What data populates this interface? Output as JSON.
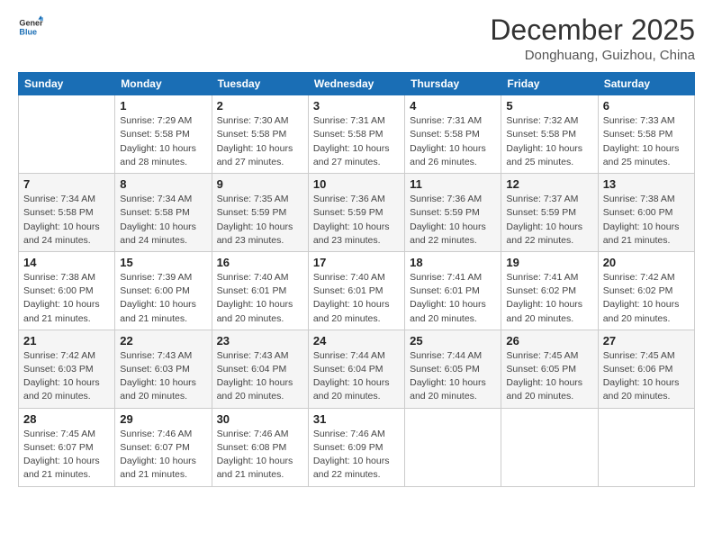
{
  "logo": {
    "line1": "General",
    "line2": "Blue"
  },
  "title": "December 2025",
  "subtitle": "Donghuang, Guizhou, China",
  "weekdays": [
    "Sunday",
    "Monday",
    "Tuesday",
    "Wednesday",
    "Thursday",
    "Friday",
    "Saturday"
  ],
  "weeks": [
    [
      {
        "num": "",
        "info": ""
      },
      {
        "num": "1",
        "info": "Sunrise: 7:29 AM\nSunset: 5:58 PM\nDaylight: 10 hours\nand 28 minutes."
      },
      {
        "num": "2",
        "info": "Sunrise: 7:30 AM\nSunset: 5:58 PM\nDaylight: 10 hours\nand 27 minutes."
      },
      {
        "num": "3",
        "info": "Sunrise: 7:31 AM\nSunset: 5:58 PM\nDaylight: 10 hours\nand 27 minutes."
      },
      {
        "num": "4",
        "info": "Sunrise: 7:31 AM\nSunset: 5:58 PM\nDaylight: 10 hours\nand 26 minutes."
      },
      {
        "num": "5",
        "info": "Sunrise: 7:32 AM\nSunset: 5:58 PM\nDaylight: 10 hours\nand 25 minutes."
      },
      {
        "num": "6",
        "info": "Sunrise: 7:33 AM\nSunset: 5:58 PM\nDaylight: 10 hours\nand 25 minutes."
      }
    ],
    [
      {
        "num": "7",
        "info": "Sunrise: 7:34 AM\nSunset: 5:58 PM\nDaylight: 10 hours\nand 24 minutes."
      },
      {
        "num": "8",
        "info": "Sunrise: 7:34 AM\nSunset: 5:58 PM\nDaylight: 10 hours\nand 24 minutes."
      },
      {
        "num": "9",
        "info": "Sunrise: 7:35 AM\nSunset: 5:59 PM\nDaylight: 10 hours\nand 23 minutes."
      },
      {
        "num": "10",
        "info": "Sunrise: 7:36 AM\nSunset: 5:59 PM\nDaylight: 10 hours\nand 23 minutes."
      },
      {
        "num": "11",
        "info": "Sunrise: 7:36 AM\nSunset: 5:59 PM\nDaylight: 10 hours\nand 22 minutes."
      },
      {
        "num": "12",
        "info": "Sunrise: 7:37 AM\nSunset: 5:59 PM\nDaylight: 10 hours\nand 22 minutes."
      },
      {
        "num": "13",
        "info": "Sunrise: 7:38 AM\nSunset: 6:00 PM\nDaylight: 10 hours\nand 21 minutes."
      }
    ],
    [
      {
        "num": "14",
        "info": "Sunrise: 7:38 AM\nSunset: 6:00 PM\nDaylight: 10 hours\nand 21 minutes."
      },
      {
        "num": "15",
        "info": "Sunrise: 7:39 AM\nSunset: 6:00 PM\nDaylight: 10 hours\nand 21 minutes."
      },
      {
        "num": "16",
        "info": "Sunrise: 7:40 AM\nSunset: 6:01 PM\nDaylight: 10 hours\nand 20 minutes."
      },
      {
        "num": "17",
        "info": "Sunrise: 7:40 AM\nSunset: 6:01 PM\nDaylight: 10 hours\nand 20 minutes."
      },
      {
        "num": "18",
        "info": "Sunrise: 7:41 AM\nSunset: 6:01 PM\nDaylight: 10 hours\nand 20 minutes."
      },
      {
        "num": "19",
        "info": "Sunrise: 7:41 AM\nSunset: 6:02 PM\nDaylight: 10 hours\nand 20 minutes."
      },
      {
        "num": "20",
        "info": "Sunrise: 7:42 AM\nSunset: 6:02 PM\nDaylight: 10 hours\nand 20 minutes."
      }
    ],
    [
      {
        "num": "21",
        "info": "Sunrise: 7:42 AM\nSunset: 6:03 PM\nDaylight: 10 hours\nand 20 minutes."
      },
      {
        "num": "22",
        "info": "Sunrise: 7:43 AM\nSunset: 6:03 PM\nDaylight: 10 hours\nand 20 minutes."
      },
      {
        "num": "23",
        "info": "Sunrise: 7:43 AM\nSunset: 6:04 PM\nDaylight: 10 hours\nand 20 minutes."
      },
      {
        "num": "24",
        "info": "Sunrise: 7:44 AM\nSunset: 6:04 PM\nDaylight: 10 hours\nand 20 minutes."
      },
      {
        "num": "25",
        "info": "Sunrise: 7:44 AM\nSunset: 6:05 PM\nDaylight: 10 hours\nand 20 minutes."
      },
      {
        "num": "26",
        "info": "Sunrise: 7:45 AM\nSunset: 6:05 PM\nDaylight: 10 hours\nand 20 minutes."
      },
      {
        "num": "27",
        "info": "Sunrise: 7:45 AM\nSunset: 6:06 PM\nDaylight: 10 hours\nand 20 minutes."
      }
    ],
    [
      {
        "num": "28",
        "info": "Sunrise: 7:45 AM\nSunset: 6:07 PM\nDaylight: 10 hours\nand 21 minutes."
      },
      {
        "num": "29",
        "info": "Sunrise: 7:46 AM\nSunset: 6:07 PM\nDaylight: 10 hours\nand 21 minutes."
      },
      {
        "num": "30",
        "info": "Sunrise: 7:46 AM\nSunset: 6:08 PM\nDaylight: 10 hours\nand 21 minutes."
      },
      {
        "num": "31",
        "info": "Sunrise: 7:46 AM\nSunset: 6:09 PM\nDaylight: 10 hours\nand 22 minutes."
      },
      {
        "num": "",
        "info": ""
      },
      {
        "num": "",
        "info": ""
      },
      {
        "num": "",
        "info": ""
      }
    ]
  ]
}
